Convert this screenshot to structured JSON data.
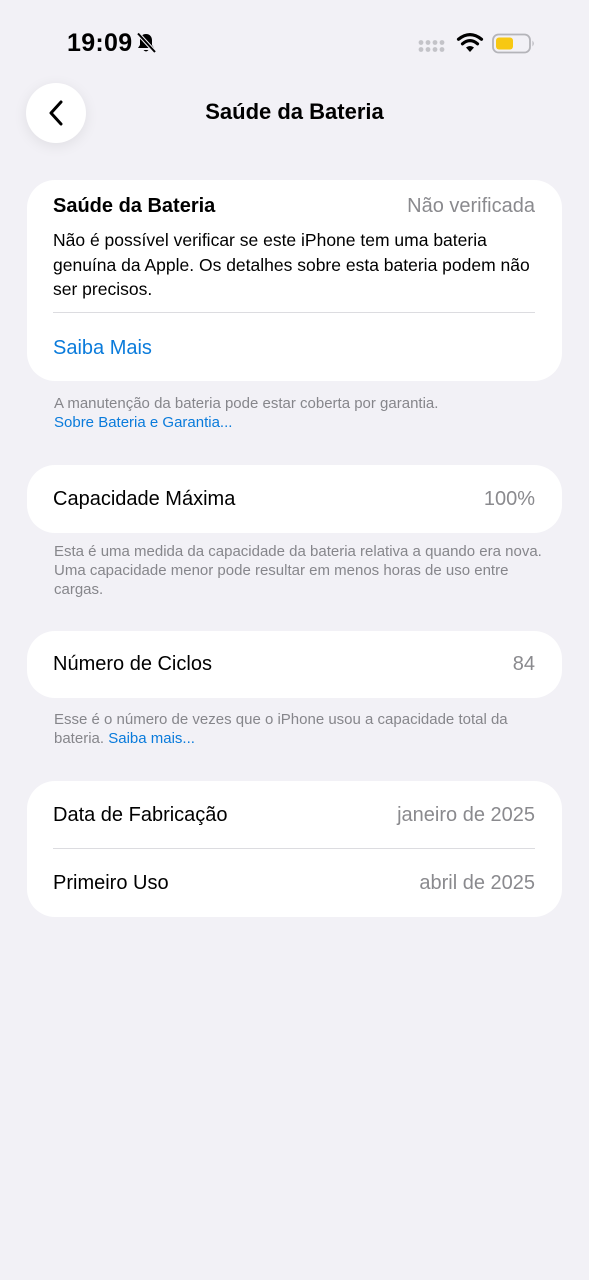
{
  "status_bar": {
    "time": "19:09",
    "icons": [
      "bell-slash-icon",
      "cellular-signal-icon",
      "wifi-icon",
      "battery-icon"
    ],
    "battery_color": "#F7C813"
  },
  "nav": {
    "back_icon": "chevron-left-icon",
    "title": "Saúde da Bateria"
  },
  "health_card": {
    "title": "Saúde da Bateria",
    "status": "Não verificada",
    "description": "Não é possível verificar se este iPhone tem uma bateria genuína da Apple. Os detalhes sobre esta bateria podem não ser precisos.",
    "link": "Saiba Mais"
  },
  "warranty_note": {
    "text": "A manutenção da bateria pode estar coberta por garantia.",
    "link": "Sobre Bateria e Garantia..."
  },
  "capacity": {
    "label": "Capacidade Máxima",
    "value": "100%",
    "note": "Esta é uma medida da capacidade da bateria relativa a quando era nova. Uma capacidade menor pode resultar em menos horas de uso entre cargas."
  },
  "cycles": {
    "label": "Número de Ciclos",
    "value": "84",
    "note": "Esse é o número de vezes que o iPhone usou a capacidade total da bateria.",
    "note_link": "Saiba mais..."
  },
  "dates": {
    "manufacture_label": "Data de Fabricação",
    "manufacture_value": "janeiro de 2025",
    "first_use_label": "Primeiro Uso",
    "first_use_value": "abril de 2025"
  },
  "colors": {
    "background": "#F2F1F6",
    "link": "#0A7BDB",
    "secondary_text": "#8A8A8E"
  }
}
